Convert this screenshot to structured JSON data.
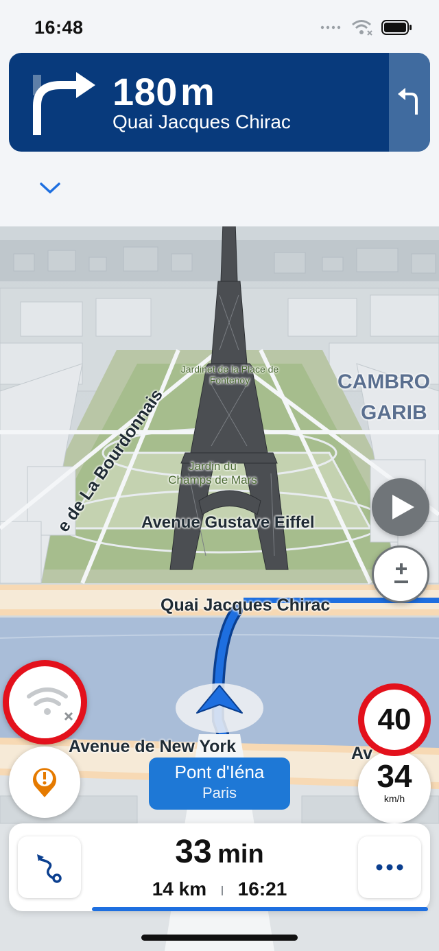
{
  "status_bar": {
    "time": "16:48"
  },
  "navigation": {
    "distance_value": "180",
    "distance_unit": "m",
    "street": "Quai Jacques Chirac",
    "banner_color": "#083a7c"
  },
  "map": {
    "labels": {
      "jardinet": "Jardinet de la Place de Fontenoy",
      "jardin": "Jardin du Champs de Mars",
      "avenue_eiffel": "Avenue Gustave Eiffel",
      "quai": "Quai Jacques Chirac",
      "bourdonnais": "e de La Bourdonnais",
      "cambro": "CAMBRO",
      "garib": "GARIB",
      "new_york": "Avenue de New York",
      "avenue_right": "Av"
    },
    "route_color": "#1e6fe0"
  },
  "current_street": {
    "name": "Pont d'Iéna",
    "city": "Paris"
  },
  "speed": {
    "limit": "40",
    "current": "34",
    "unit": "km/h"
  },
  "trip": {
    "duration_value": "33",
    "duration_unit": "min",
    "distance": "14 km",
    "arrival": "16:21"
  },
  "icons": {
    "collapse": "chevron-down-icon",
    "play": "play-icon",
    "zoom": "plus-minus-icon",
    "offline": "wifi-off-icon",
    "report": "incident-report-icon",
    "route": "route-icon",
    "more": "more-icon"
  }
}
